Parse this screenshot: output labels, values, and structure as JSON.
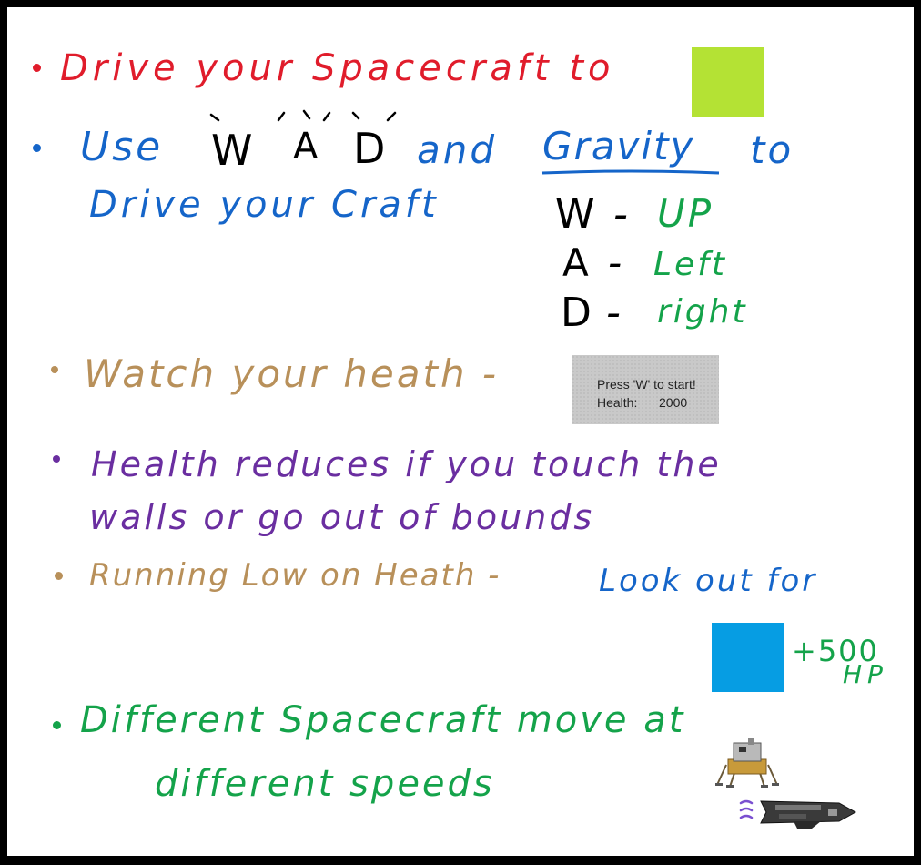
{
  "colors": {
    "red": "#e01c2b",
    "blue": "#1565c9",
    "black": "#000000",
    "green": "#14a34a",
    "tan": "#b8905a",
    "purple": "#6a2ea0",
    "goal_square": "#b4e234",
    "powerup_square": "#069de3"
  },
  "goal": {
    "text": "Drive your Spacecraft to",
    "icon": "goal-lime-square"
  },
  "controls": {
    "use": "Use",
    "keys": [
      "W",
      "A",
      "D"
    ],
    "and": "and",
    "gravity": "Gravity",
    "to": "to",
    "line2": "Drive your Craft",
    "mapping": [
      {
        "key": "W",
        "sep": "-",
        "action": "UP"
      },
      {
        "key": "A",
        "sep": "-",
        "action": "Left"
      },
      {
        "key": "D",
        "sep": "-",
        "action": "right"
      }
    ]
  },
  "health_tip": {
    "text": "Watch your heath -",
    "hud_line1": "Press 'W' to start!",
    "hud_label": "Health:",
    "hud_value": "2000"
  },
  "damage_tip": {
    "line1": "Health reduces if you touch the",
    "line2": "walls or go out of bounds"
  },
  "low_health_tip": {
    "text_tan": "Running Low on Heath -",
    "text_blue": "Look out for",
    "powerup_icon": "powerup-blue-square",
    "bonus": "+500",
    "unit": "HP"
  },
  "speed_tip": {
    "line1": "Different Spacecraft move at",
    "line2": "different speeds",
    "craft_icons": [
      "lunar-lander-icon",
      "spaceship-icon"
    ]
  }
}
